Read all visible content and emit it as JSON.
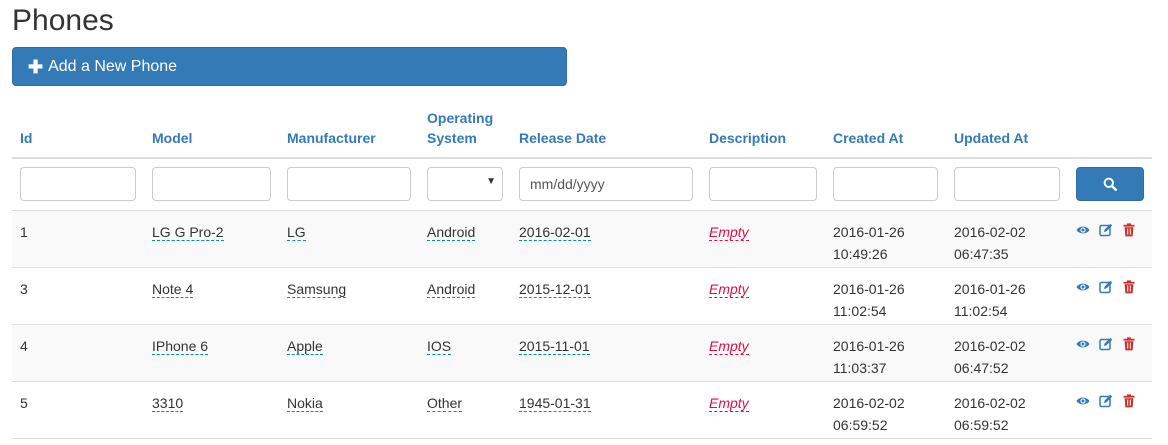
{
  "page": {
    "title": "Phones"
  },
  "toolbar": {
    "add_label": "Add a New Phone",
    "add_icon": "plus-icon"
  },
  "columns": [
    "Id",
    "Model",
    "Manufacturer",
    "Operating System",
    "Release Date",
    "Description",
    "Created At",
    "Updated At"
  ],
  "filters": {
    "date_placeholder": "mm/dd/yyyy",
    "search_icon": "search-icon"
  },
  "rows": [
    {
      "id": "1",
      "model": "LG G Pro-2",
      "manufacturer": "LG",
      "os": "Android",
      "release": "2016-02-01",
      "description": "Empty",
      "created_date": "2016-01-26",
      "created_time": "10:49:26",
      "updated_date": "2016-02-02",
      "updated_time": "06:47:35"
    },
    {
      "id": "3",
      "model": "Note 4",
      "manufacturer": "Samsung",
      "os": "Android",
      "release": "2015-12-01",
      "description": "Empty",
      "created_date": "2016-01-26",
      "created_time": "11:02:54",
      "updated_date": "2016-01-26",
      "updated_time": "11:02:54"
    },
    {
      "id": "4",
      "model": "IPhone 6",
      "manufacturer": "Apple",
      "os": "IOS",
      "release": "2015-11-01",
      "description": "Empty",
      "created_date": "2016-01-26",
      "created_time": "11:03:37",
      "updated_date": "2016-02-02",
      "updated_time": "06:47:52"
    },
    {
      "id": "5",
      "model": "3310",
      "manufacturer": "Nokia",
      "os": "Other",
      "release": "1945-01-31",
      "description": "Empty",
      "created_date": "2016-02-02",
      "created_time": "06:59:52",
      "updated_date": "2016-02-02",
      "updated_time": "06:59:52"
    }
  ],
  "row_actions": [
    "eye-icon",
    "edit-icon",
    "trash-icon"
  ],
  "colors": {
    "primary": "#337ab7",
    "empty": "#dd1144",
    "danger": "#c9302c"
  }
}
